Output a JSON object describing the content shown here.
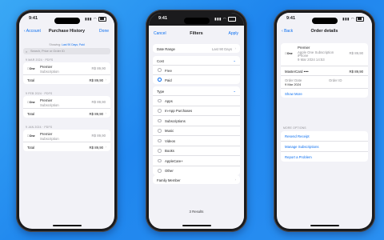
{
  "status": {
    "time": "9:41"
  },
  "phone1": {
    "back": "Account",
    "title": "Purchase History",
    "done": "Done",
    "showing_prefix": "Showing:",
    "showing_value": "Last 90 Days; Paid",
    "search_placeholder": "Search, Price or Order ID",
    "groups": [
      {
        "header": "9 MAR 2024 · Pdfs",
        "logo": "One",
        "name": "Premier",
        "sub": "Subscription",
        "price": "R$ 89,90",
        "total_label": "Total",
        "total": "R$ 89,90"
      },
      {
        "header": "9 FEB 2024 · Pdfs",
        "logo": "One",
        "name": "Premier",
        "sub": "Subscription",
        "price": "R$ 89,90",
        "total_label": "Total",
        "total": "R$ 89,90"
      },
      {
        "header": "9 JAN 2024 · Pdfs",
        "logo": "One",
        "name": "Premier",
        "sub": "Subscription",
        "price": "R$ 89,90",
        "total_label": "Total",
        "total": "R$ 89,90"
      }
    ]
  },
  "phone2": {
    "cancel": "Cancel",
    "title": "Filters",
    "apply": "Apply",
    "date_range_label": "Date Range",
    "date_range_value": "Last 90 Days",
    "cost_label": "Cost",
    "cost_options": [
      {
        "label": "Free",
        "selected": false
      },
      {
        "label": "Paid",
        "selected": true
      }
    ],
    "type_label": "Type",
    "type_options": [
      "Apps",
      "In-App Purchases",
      "Subscriptions",
      "Music",
      "Videos",
      "Books",
      "AppleCare+",
      "Other"
    ],
    "family_label": "Family Member",
    "results": "3 Results"
  },
  "phone3": {
    "back": "Back",
    "title": "Order details",
    "logo": "One",
    "item_name": "Premier",
    "item_desc1": "Apple One Subscription",
    "item_desc2": "iPhone",
    "item_date": "9 Mar 2024 14:53",
    "item_price": "R$ 89,90",
    "payment_label": "MasterCard ••••",
    "payment_amount": "R$ 89,90",
    "order_date_label": "Order Date",
    "order_date_value": "9 Mar 2024",
    "order_id_label": "Order ID",
    "show_more": "Show More",
    "more_options_label": "MORE OPTIONS",
    "options": [
      "Resend Receipt",
      "Manage Subscriptions",
      "Report a Problem"
    ]
  }
}
